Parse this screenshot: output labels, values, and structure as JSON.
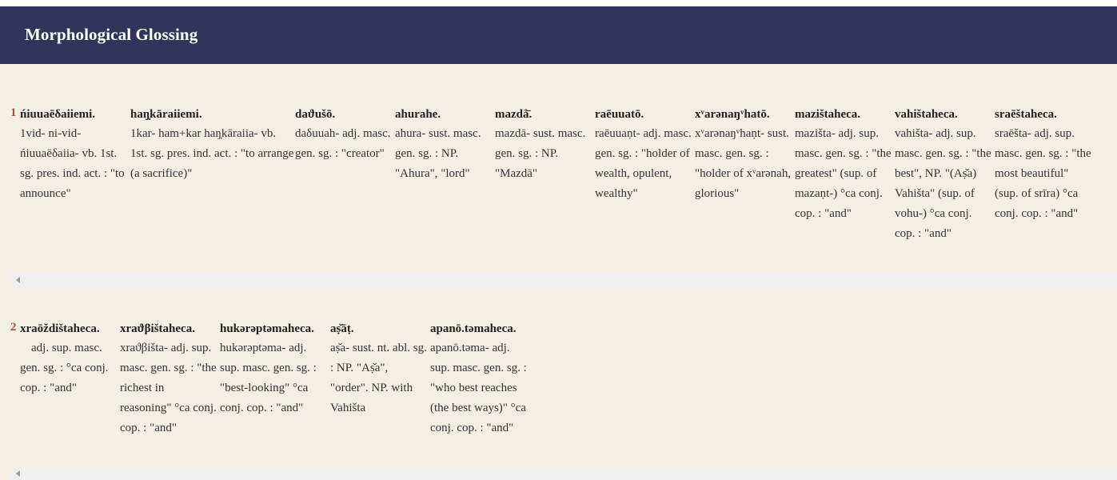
{
  "header": {
    "title": "Morphological Glossing"
  },
  "verses": [
    {
      "number": "1",
      "words": [
        {
          "form": "ńiuuaēδaiiemi.",
          "gloss": "1vid- ni-vid- ńiuuaēδaiia- vb. 1st. sg. pres. ind. act. : \"to announce\""
        },
        {
          "form": "haŋ̣kāraiiemi.",
          "gloss": "1kar- ham+kar haŋ̣kāraiia- vb. 1st. sg. pres. ind. act. : \"to arrange (a sacrifice)\""
        },
        {
          "form": "daϑušō.",
          "gloss": "daδuuah- adj. masc. gen. sg. : \"creator\""
        },
        {
          "form": "ahurahe.",
          "gloss": "ahura- sust. masc. gen. sg. : NP. \"Ahura\", \"lord\""
        },
        {
          "form": "mazdå̄.",
          "gloss": "mazdā- sust. masc. gen. sg. : NP. \"Mazdā\""
        },
        {
          "form": "raēuuatō.",
          "gloss": "raēuuaṇt- adj. masc. gen. sg. : \"holder of wealth, opulent, wealthy\""
        },
        {
          "form": "xᵛarənaŋᵛhatō.",
          "gloss": "xᵛarənaŋᵛhaṇt- sust. masc. gen. sg. : \"holder of xᵛarənah, glorious\""
        },
        {
          "form": "mazištaheca.",
          "gloss": "mazišta- adj. sup. masc. gen. sg. : \"the greatest\" (sup. of mazaṇt-) °ca conj. cop. : \"and\""
        },
        {
          "form": "vahištaheca.",
          "gloss": "vahišta- adj. sup. masc. gen. sg. : \"the best\", NP. \"(Aṣ̌a) Vahišta\" (sup. of vohu-) °ca conj. cop. : \"and\""
        },
        {
          "form": "sraēštaheca.",
          "gloss": "sraēšta- adj. sup. masc. gen. sg. : \"the most beautiful\" (sup. of srīra) °ca conj. cop. : \"and\""
        }
      ]
    },
    {
      "number": "2",
      "words": [
        {
          "form": "xraōždištaheca.",
          "gloss": "adj. sup. masc. gen. sg. : °ca conj. cop. : \"and\""
        },
        {
          "form": "xraϑβištaheca.",
          "gloss": "xraϑβišta- adj. sup. masc. gen. sg. : \"the richest in reasoning\" °ca conj. cop. : \"and\""
        },
        {
          "form": "hukərəptəmaheca.",
          "gloss": "hukərəptəma- adj. sup. masc. gen. sg. : \"best-looking\" °ca conj. cop. : \"and\""
        },
        {
          "form": "aṣ̌āṭ.",
          "gloss": "aṣ̌a- sust. nt. abl. sg. : NP. \"Aṣ̌a\", \"order\". NP. with Vahišta"
        },
        {
          "form": "apanō.təmaheca.",
          "gloss": "apanō.təma- adj. sup. masc. gen. sg. : \"who best reaches (the best ways)\" °ca conj. cop. : \"and\""
        }
      ]
    }
  ]
}
